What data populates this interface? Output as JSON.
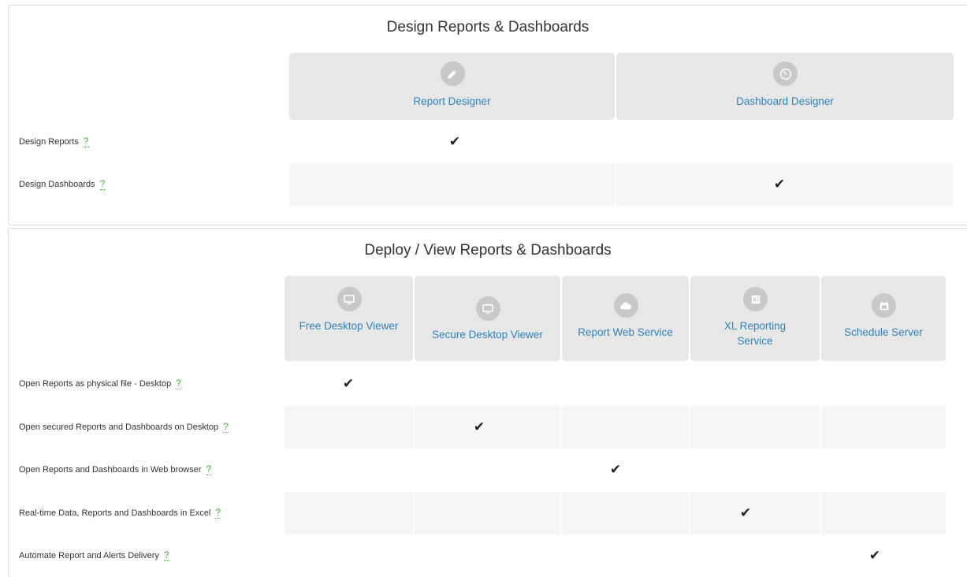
{
  "design": {
    "title": "Design Reports & Dashboards",
    "columns": [
      {
        "label": "Report Designer",
        "icon": "pencil-icon"
      },
      {
        "label": "Dashboard Designer",
        "icon": "gauge-icon"
      }
    ],
    "rows": [
      {
        "label": "Design Reports",
        "help": "?",
        "check_col": 0
      },
      {
        "label": "Design Dashboards",
        "help": "?",
        "check_col": 1
      }
    ]
  },
  "deploy": {
    "title": "Deploy / View Reports & Dashboards",
    "columns": [
      {
        "label": "Free Desktop Viewer",
        "icon": "monitor-icon"
      },
      {
        "label": "Secure Desktop Viewer",
        "icon": "monitor-icon"
      },
      {
        "label": "Report Web Service",
        "icon": "cloud-icon"
      },
      {
        "label": "XL Reporting Service",
        "icon": "excel-icon"
      },
      {
        "label": "Schedule Server",
        "icon": "calendar-icon"
      }
    ],
    "rows": [
      {
        "label": "Open Reports as physical file - Desktop",
        "help": "?",
        "check_col": 0
      },
      {
        "label": "Open secured Reports and Dashboards on Desktop",
        "help": "?",
        "check_col": 1
      },
      {
        "label": "Open Reports and Dashboards in Web browser",
        "help": "?",
        "check_col": 2
      },
      {
        "label": "Real-time Data, Reports and Dashboards in Excel",
        "help": "?",
        "check_col": 3
      },
      {
        "label": "Automate Report and Alerts Delivery",
        "help": "?",
        "check_col": 4
      }
    ]
  },
  "check_glyph": "✔",
  "colors": {
    "accent": "#2f83b8",
    "help": "#3fb53a",
    "header_bg": "#e7e7e7",
    "icon_bg": "#c8c8c8"
  }
}
